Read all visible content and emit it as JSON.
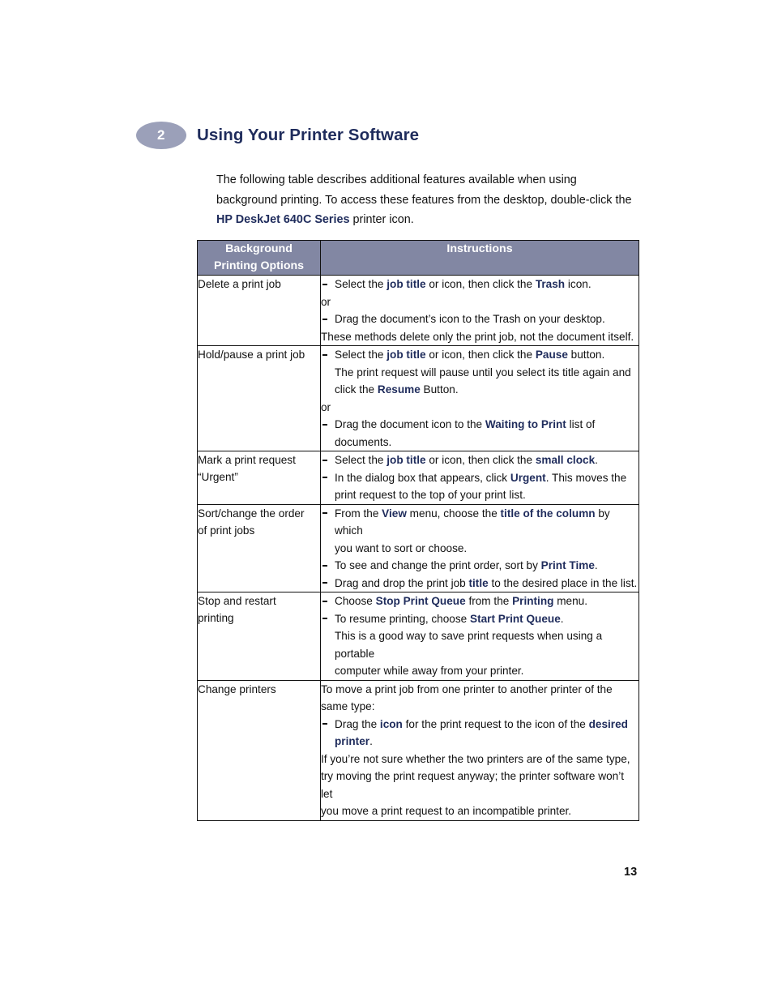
{
  "colors": {
    "navy": "#1f2c5c",
    "badge_fill": "#9ba0b9",
    "table_header_fill": "#8287a3",
    "border": "#111111",
    "body_text": "#111111"
  },
  "chapter": {
    "number": "2",
    "title": "Using Your Printer Software"
  },
  "intro": {
    "line1": "The following table describes additional features available when using",
    "line2": "background printing. To access these features from the desktop, double-click the",
    "line3_bold": "HP DeskJet 640C Series",
    "line3_rest": " printer icon."
  },
  "table": {
    "headers": {
      "col1_line1": "Background",
      "col1_line2": "Printing Options",
      "col2": "Instructions"
    },
    "rows": [
      {
        "option_lines": [
          "Delete a print job"
        ],
        "instruction_lines": [
          {
            "type": "bullet",
            "parts": [
              {
                "text": "Select the ",
                "bold": false
              },
              {
                "text": "job title",
                "bold": true
              },
              {
                "text": " or icon, then click the ",
                "bold": false
              },
              {
                "text": "Trash",
                "bold": true
              },
              {
                "text": " icon.",
                "bold": false
              }
            ]
          },
          {
            "type": "plain",
            "parts": [
              {
                "text": "or",
                "bold": false
              }
            ]
          },
          {
            "type": "bullet",
            "parts": [
              {
                "text": "Drag the document’s icon to the Trash on your desktop.",
                "bold": false
              }
            ]
          },
          {
            "type": "plain",
            "parts": [
              {
                "text": "These methods delete only the print job, not the document itself.",
                "bold": false
              }
            ]
          }
        ]
      },
      {
        "option_lines": [
          "Hold/pause a print job"
        ],
        "instruction_lines": [
          {
            "type": "bullet",
            "parts": [
              {
                "text": "Select the ",
                "bold": false
              },
              {
                "text": "job title",
                "bold": true
              },
              {
                "text": " or icon, then click the ",
                "bold": false
              },
              {
                "text": "Pause",
                "bold": true
              },
              {
                "text": " button.",
                "bold": false
              }
            ]
          },
          {
            "type": "cont",
            "parts": [
              {
                "text": "The print request will pause until you select its title again and",
                "bold": false
              }
            ]
          },
          {
            "type": "cont",
            "parts": [
              {
                "text": "click the ",
                "bold": false
              },
              {
                "text": "Resume",
                "bold": true
              },
              {
                "text": " Button.",
                "bold": false
              }
            ]
          },
          {
            "type": "plain",
            "parts": [
              {
                "text": "or",
                "bold": false
              }
            ]
          },
          {
            "type": "bullet",
            "parts": [
              {
                "text": "Drag the document icon to the ",
                "bold": false
              },
              {
                "text": "Waiting to Print",
                "bold": true
              },
              {
                "text": " list of",
                "bold": false
              }
            ]
          },
          {
            "type": "cont",
            "parts": [
              {
                "text": "documents.",
                "bold": false
              }
            ]
          }
        ]
      },
      {
        "option_lines": [
          "Mark a print request",
          "“Urgent”"
        ],
        "instruction_lines": [
          {
            "type": "bullet",
            "parts": [
              {
                "text": "Select the ",
                "bold": false
              },
              {
                "text": "job title",
                "bold": true
              },
              {
                "text": " or icon, then click the ",
                "bold": false
              },
              {
                "text": "small clock",
                "bold": true
              },
              {
                "text": ".",
                "bold": false
              }
            ]
          },
          {
            "type": "bullet",
            "parts": [
              {
                "text": "In the dialog box that appears, click ",
                "bold": false
              },
              {
                "text": "Urgent",
                "bold": true
              },
              {
                "text": ". This moves the",
                "bold": false
              }
            ]
          },
          {
            "type": "cont",
            "parts": [
              {
                "text": "print request to the top of your print list.",
                "bold": false
              }
            ]
          }
        ]
      },
      {
        "option_lines": [
          "Sort/change the order",
          "of print jobs"
        ],
        "instruction_lines": [
          {
            "type": "bullet",
            "parts": [
              {
                "text": "From the ",
                "bold": false
              },
              {
                "text": "View",
                "bold": true
              },
              {
                "text": " menu, choose the ",
                "bold": false
              },
              {
                "text": "title of the column",
                "bold": true
              },
              {
                "text": " by which",
                "bold": false
              }
            ]
          },
          {
            "type": "cont",
            "parts": [
              {
                "text": "you want to sort or choose.",
                "bold": false
              }
            ]
          },
          {
            "type": "bullet",
            "parts": [
              {
                "text": "To see and change the print order, sort by ",
                "bold": false
              },
              {
                "text": "Print Time",
                "bold": true
              },
              {
                "text": ".",
                "bold": false
              }
            ]
          },
          {
            "type": "bullet",
            "parts": [
              {
                "text": "Drag and drop the print job ",
                "bold": false
              },
              {
                "text": "title",
                "bold": true
              },
              {
                "text": " to the desired place in the list.",
                "bold": false
              }
            ]
          }
        ]
      },
      {
        "option_lines": [
          "Stop and restart",
          "printing"
        ],
        "instruction_lines": [
          {
            "type": "bullet",
            "parts": [
              {
                "text": "Choose ",
                "bold": false
              },
              {
                "text": "Stop Print Queue",
                "bold": true
              },
              {
                "text": " from the ",
                "bold": false
              },
              {
                "text": "Printing",
                "bold": true
              },
              {
                "text": " menu.",
                "bold": false
              }
            ]
          },
          {
            "type": "bullet",
            "parts": [
              {
                "text": "To resume printing, choose ",
                "bold": false
              },
              {
                "text": "Start Print Queue",
                "bold": true
              },
              {
                "text": ".",
                "bold": false
              }
            ]
          },
          {
            "type": "cont",
            "parts": [
              {
                "text": "This is a good way to save print requests when using a portable",
                "bold": false
              }
            ]
          },
          {
            "type": "cont",
            "parts": [
              {
                "text": "computer while away from your printer.",
                "bold": false
              }
            ]
          }
        ]
      },
      {
        "option_lines": [
          "Change printers"
        ],
        "instruction_lines": [
          {
            "type": "plain",
            "parts": [
              {
                "text": "To move a print job from one printer to another printer of the",
                "bold": false
              }
            ]
          },
          {
            "type": "plain",
            "parts": [
              {
                "text": "same type:",
                "bold": false
              }
            ]
          },
          {
            "type": "bullet",
            "parts": [
              {
                "text": "Drag the ",
                "bold": false
              },
              {
                "text": "icon",
                "bold": true
              },
              {
                "text": " for the print request to the icon of the ",
                "bold": false
              },
              {
                "text": "desired",
                "bold": true
              }
            ]
          },
          {
            "type": "cont",
            "parts": [
              {
                "text": "printer",
                "bold": true
              },
              {
                "text": ".",
                "bold": false
              }
            ]
          },
          {
            "type": "plain",
            "parts": [
              {
                "text": "If you’re not sure whether the two printers are of the same type,",
                "bold": false
              }
            ]
          },
          {
            "type": "plain",
            "parts": [
              {
                "text": "try moving the print request anyway; the printer software won’t let",
                "bold": false
              }
            ]
          },
          {
            "type": "plain",
            "parts": [
              {
                "text": "you move a print request to an incompatible printer.",
                "bold": false
              }
            ]
          }
        ]
      }
    ]
  },
  "footer": {
    "page_number": "13"
  }
}
